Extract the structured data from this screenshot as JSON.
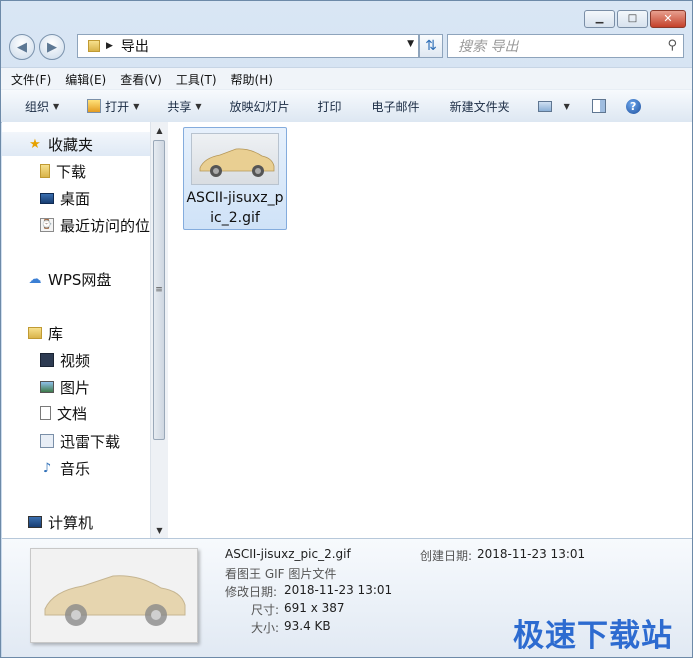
{
  "window": {
    "caption_buttons": {
      "minimize": "▁",
      "maximize": "□",
      "close": "✕"
    }
  },
  "navigation": {
    "back_glyph": "◀",
    "forward_glyph": "▶",
    "address_path": "导出",
    "search_placeholder": "搜索 导出"
  },
  "menu": [
    "文件(F)",
    "编辑(E)",
    "查看(V)",
    "工具(T)",
    "帮助(H)"
  ],
  "toolbar": {
    "organize": "组织",
    "open": "打开",
    "share": "共享",
    "slideshow": "放映幻灯片",
    "print": "打印",
    "email": "电子邮件",
    "new_folder": "新建文件夹"
  },
  "sidebar": {
    "favorites": "收藏夹",
    "downloads": "下载",
    "desktop": "桌面",
    "recent": "最近访问的位置",
    "wps": "WPS网盘",
    "libraries": "库",
    "videos": "视频",
    "pictures": "图片",
    "documents": "文档",
    "thunder": "迅雷下载",
    "music": "音乐",
    "computer": "计算机"
  },
  "files": [
    {
      "name": "ASCII-jisuxz_pic_2.gif"
    }
  ],
  "details": {
    "filename": "ASCII-jisuxz_pic_2.gif",
    "type": "看图王 GIF 图片文件",
    "modified_label": "修改日期:",
    "modified_value": "2018-11-23 13:01",
    "created_label": "创建日期:",
    "created_value": "2018-11-23 13:01",
    "dimensions_label": "尺寸:",
    "dimensions_value": "691 x 387",
    "size_label": "大小:",
    "size_value": "93.4 KB"
  },
  "watermark": "极速下载站",
  "colors": {
    "accent": "#2d6bd0",
    "selection": "#cfe2f7"
  }
}
